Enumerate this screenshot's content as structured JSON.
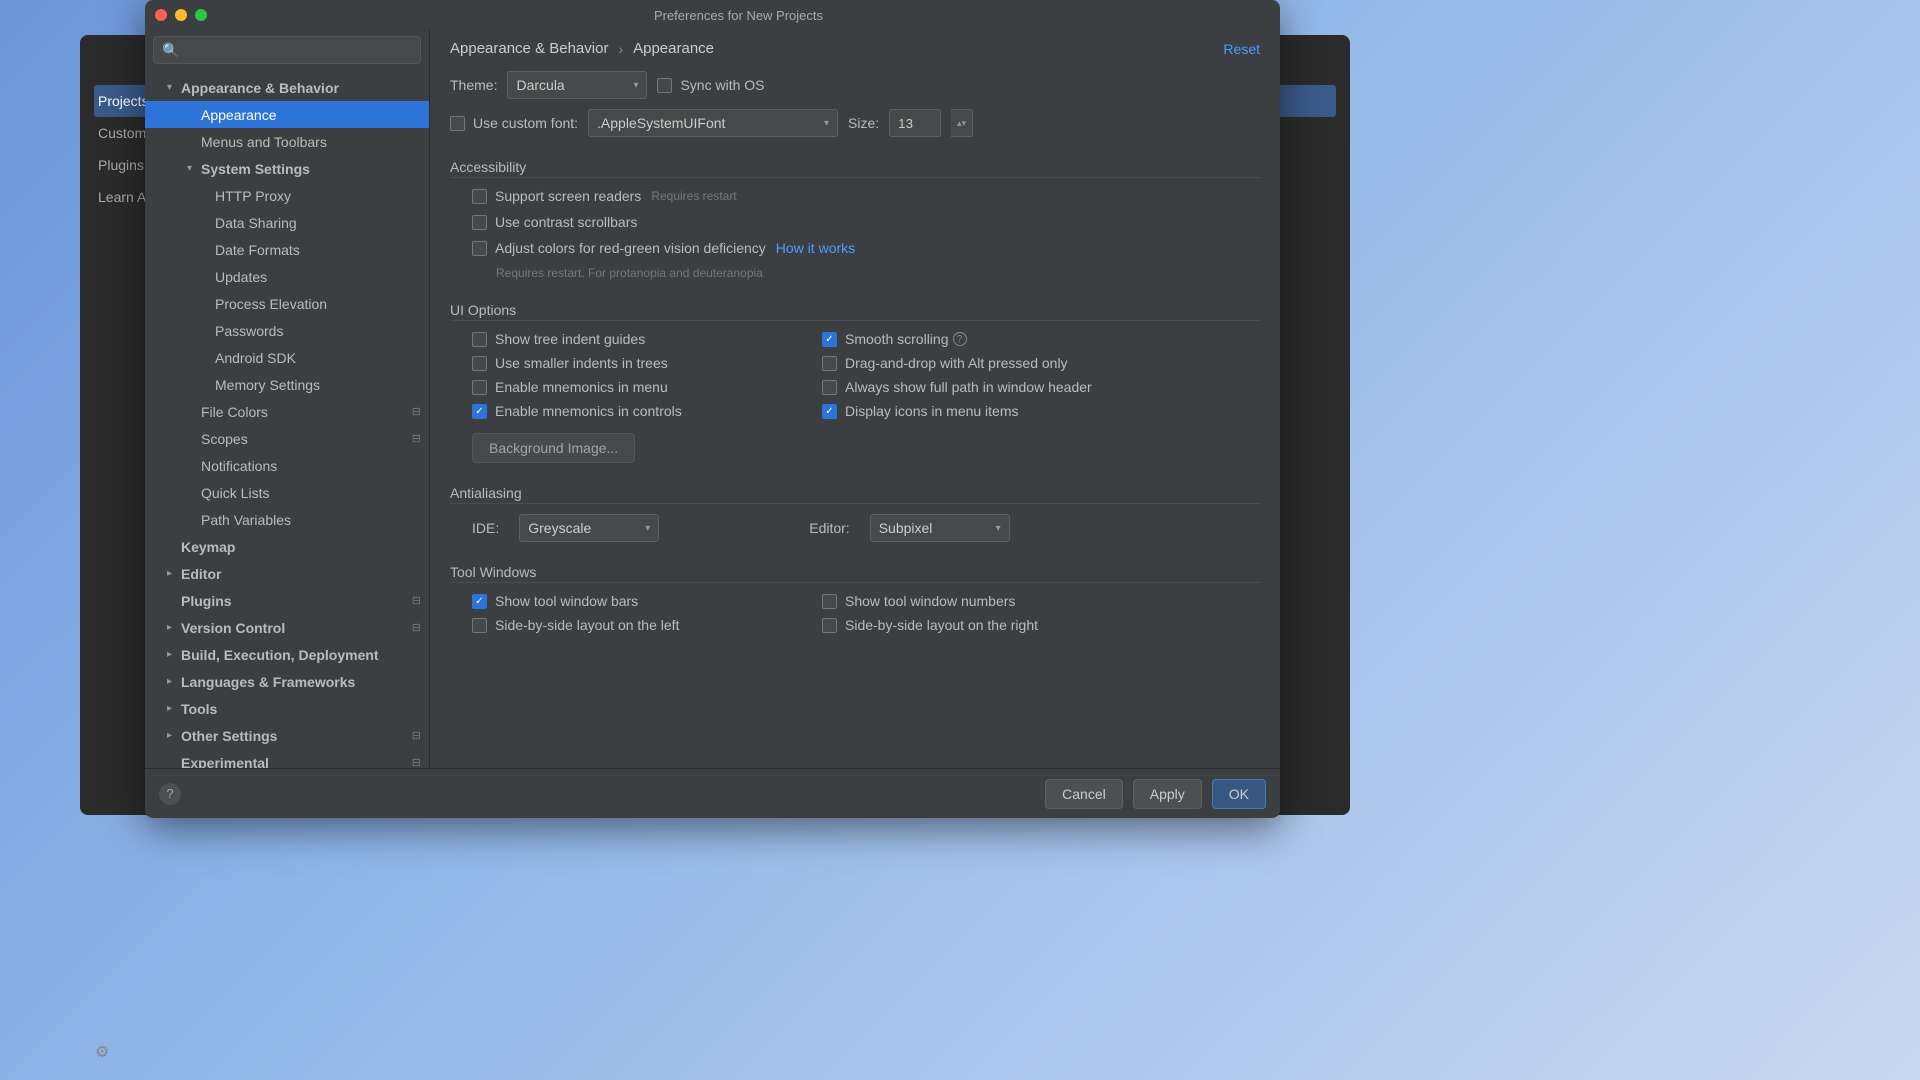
{
  "title": "Preferences for New Projects",
  "underlay": {
    "items": [
      "Projects",
      "Customize",
      "Plugins",
      "Learn A..."
    ],
    "selected_index": 0
  },
  "search_placeholder": "",
  "tree": [
    {
      "l": 1,
      "lbl": "Appearance & Behavior",
      "bold": true,
      "exp": true
    },
    {
      "l": 2,
      "lbl": "Appearance",
      "sel": true
    },
    {
      "l": 2,
      "lbl": "Menus and Toolbars"
    },
    {
      "l": 2,
      "lbl": "System Settings",
      "bold": true,
      "exp": true
    },
    {
      "l": 3,
      "lbl": "HTTP Proxy"
    },
    {
      "l": 3,
      "lbl": "Data Sharing"
    },
    {
      "l": 3,
      "lbl": "Date Formats"
    },
    {
      "l": 3,
      "lbl": "Updates"
    },
    {
      "l": 3,
      "lbl": "Process Elevation"
    },
    {
      "l": 3,
      "lbl": "Passwords"
    },
    {
      "l": 3,
      "lbl": "Android SDK"
    },
    {
      "l": 3,
      "lbl": "Memory Settings"
    },
    {
      "l": 2,
      "lbl": "File Colors",
      "cfg": true
    },
    {
      "l": 2,
      "lbl": "Scopes",
      "cfg": true
    },
    {
      "l": 2,
      "lbl": "Notifications"
    },
    {
      "l": 2,
      "lbl": "Quick Lists"
    },
    {
      "l": 2,
      "lbl": "Path Variables"
    },
    {
      "l": 1,
      "lbl": "Keymap",
      "bold": true
    },
    {
      "l": 1,
      "lbl": "Editor",
      "bold": true,
      "chev": true
    },
    {
      "l": 1,
      "lbl": "Plugins",
      "bold": true,
      "cfg": true
    },
    {
      "l": 1,
      "lbl": "Version Control",
      "bold": true,
      "chev": true,
      "cfg": true
    },
    {
      "l": 1,
      "lbl": "Build, Execution, Deployment",
      "bold": true,
      "chev": true
    },
    {
      "l": 1,
      "lbl": "Languages & Frameworks",
      "bold": true,
      "chev": true
    },
    {
      "l": 1,
      "lbl": "Tools",
      "bold": true,
      "chev": true
    },
    {
      "l": 1,
      "lbl": "Other Settings",
      "bold": true,
      "chev": true,
      "cfg": true
    },
    {
      "l": 1,
      "lbl": "Experimental",
      "bold": true,
      "cfg": true
    }
  ],
  "crumbs": {
    "a": "Appearance & Behavior",
    "b": "Appearance",
    "reset": "Reset"
  },
  "theme": {
    "label": "Theme:",
    "value": "Darcula",
    "sync": "Sync with OS"
  },
  "font": {
    "chk": "Use custom font:",
    "value": ".AppleSystemUIFont",
    "size_label": "Size:",
    "size": "13"
  },
  "sections": {
    "accessibility": "Accessibility",
    "ui": "UI Options",
    "aa": "Antialiasing",
    "tw": "Tool Windows"
  },
  "access": {
    "screen": "Support screen readers",
    "screen_hint": "Requires restart",
    "contrast": "Use contrast scrollbars",
    "color": "Adjust colors for red-green vision deficiency",
    "how": "How it works",
    "color_hint": "Requires restart. For protanopia and deuteranopia"
  },
  "ui": {
    "tree_indent": "Show tree indent guides",
    "smooth": "Smooth scrolling",
    "small_indent": "Use smaller indents in trees",
    "dnd": "Drag-and-drop with Alt pressed only",
    "mnem_menu": "Enable mnemonics in menu",
    "full_path": "Always show full path in window header",
    "mnem_ctrl": "Enable mnemonics in controls",
    "icons": "Display icons in menu items",
    "bg": "Background Image..."
  },
  "aa": {
    "ide_label": "IDE:",
    "ide": "Greyscale",
    "editor_label": "Editor:",
    "editor": "Subpixel"
  },
  "tw": {
    "bars": "Show tool window bars",
    "numbers": "Show tool window numbers",
    "left": "Side-by-side layout on the left",
    "right": "Side-by-side layout on the right"
  },
  "footer": {
    "cancel": "Cancel",
    "apply": "Apply",
    "ok": "OK"
  }
}
